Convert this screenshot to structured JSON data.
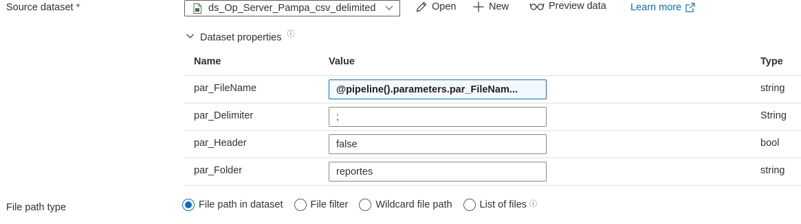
{
  "source_dataset": {
    "label": "Source dataset",
    "required_mark": "*",
    "selected": "ds_Op_Server_Pampa_csv_delimited",
    "actions": {
      "open": "Open",
      "new": "New",
      "preview": "Preview data",
      "learn_more": "Learn more"
    }
  },
  "dataset_properties": {
    "title": "Dataset properties",
    "info": "ⓘ",
    "columns": {
      "name": "Name",
      "value": "Value",
      "type": "Type"
    },
    "rows": [
      {
        "name": "par_FileName",
        "value": "@pipeline().parameters.par_FileNam...",
        "type": "string"
      },
      {
        "name": "par_Delimiter",
        "value": ";",
        "type": "String"
      },
      {
        "name": "par_Header",
        "value": "false",
        "type": "bool"
      },
      {
        "name": "par_Folder",
        "value": "reportes",
        "type": "string"
      }
    ]
  },
  "file_path_type": {
    "label": "File path type",
    "options": [
      "File path in dataset",
      "File filter",
      "Wildcard file path",
      "List of files"
    ],
    "selected_index": 0,
    "info": "ⓘ"
  },
  "colors": {
    "accent": "#0f6cbd",
    "required": "#a4262c"
  }
}
